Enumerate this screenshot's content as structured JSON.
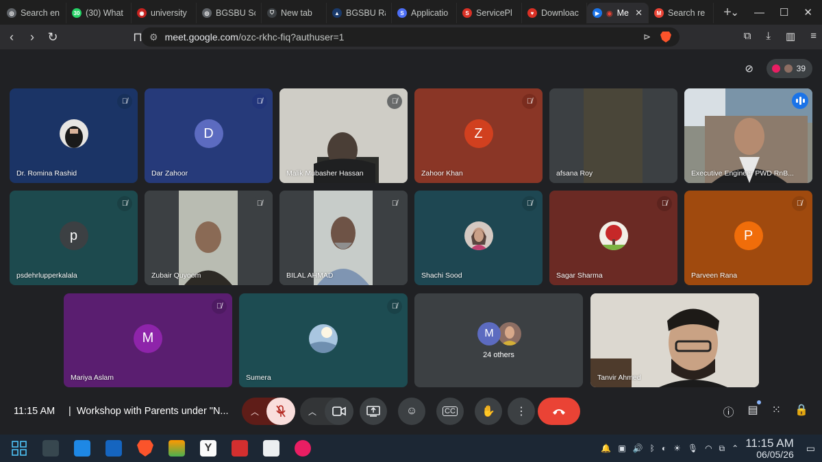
{
  "browser": {
    "tabs": [
      {
        "label": "Search en",
        "color": "#5f6368"
      },
      {
        "label": "(30) What",
        "color": "#25d366",
        "badge": "30"
      },
      {
        "label": "university",
        "color": "#c5221f"
      },
      {
        "label": "BGSBU Sc",
        "color": "#5f6368"
      },
      {
        "label": "New tab",
        "color": "#3c4043"
      },
      {
        "label": "BGSBU Ra",
        "color": "#1a3a6b"
      },
      {
        "label": "Applicatio",
        "color": "#4c6ef5",
        "badge": "S"
      },
      {
        "label": "ServicePl",
        "color": "#d93025"
      },
      {
        "label": "Downloac",
        "color": "#d93025"
      },
      {
        "label": "Me",
        "color": "#1a73e8",
        "active": true
      },
      {
        "label": "Search re",
        "color": "#ea4335",
        "badge": "M"
      }
    ],
    "url_host": "meet.google.com",
    "url_path": "/ozc-rkhc-fiq?authuser=1"
  },
  "meet": {
    "participant_count": "39",
    "tiles": [
      {
        "name": "Dr. Romina Rashid",
        "muted": true
      },
      {
        "name": "Dar Zahoor",
        "initial": "D",
        "muted": true
      },
      {
        "name": "Malik Mubasher Hassan",
        "muted": true
      },
      {
        "name": "Zahoor Khan",
        "initial": "Z",
        "muted": true
      },
      {
        "name": "afsana Roy",
        "muted": false
      },
      {
        "name": "Executive Engineer PWD RnB...",
        "speaking": true
      },
      {
        "name": "psdehrlupperkalala",
        "initial": "p",
        "muted": true
      },
      {
        "name": "Zubair Quyoom",
        "muted": true
      },
      {
        "name": "BILAL AHMAD",
        "muted": true
      },
      {
        "name": "Shachi Sood",
        "muted": true
      },
      {
        "name": "Sagar Sharma",
        "muted": true
      },
      {
        "name": "Parveen Rana",
        "initial": "P",
        "muted": true
      },
      {
        "name": "Mariya Aslam",
        "initial": "M",
        "muted": true
      },
      {
        "name": "Sumera",
        "muted": true
      },
      {
        "name": "24 others",
        "initial": "M"
      },
      {
        "name": "Tanvir Ahmed"
      }
    ],
    "bottom": {
      "time": "11:15 AM",
      "separator": "|",
      "title": "Workshop with Parents under \"N..."
    }
  },
  "taskbar": {
    "time": "11:15 AM",
    "date": "06/05/26"
  },
  "colors": {
    "meet_bg": "#202124",
    "mic_off_bg": "#f9dedc",
    "hangup": "#ea4335",
    "speaking": "#8ab4f8"
  }
}
